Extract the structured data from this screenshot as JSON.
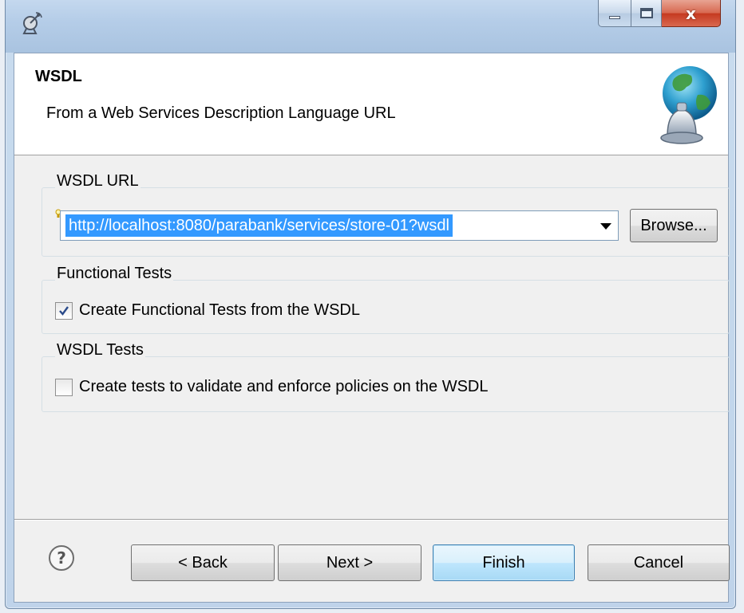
{
  "window": {
    "controls": {
      "minimize_icon": "minimize-icon",
      "maximize_icon": "maximize-icon",
      "close_glyph": "x"
    }
  },
  "header": {
    "title": "WSDL",
    "description": "From a Web Services Description Language URL"
  },
  "wsdl_url": {
    "group_label": "WSDL URL",
    "value": "http://localhost:8080/parabank/services/store-01?wsdl",
    "browse_label": "Browse..."
  },
  "functional_tests": {
    "group_label": "Functional Tests",
    "checkbox_label": "Create Functional Tests from the WSDL",
    "checked": true
  },
  "wsdl_tests": {
    "group_label": "WSDL Tests",
    "checkbox_label": "Create tests to validate and enforce policies on the WSDL",
    "checked": false
  },
  "footer": {
    "help_glyph": "?",
    "back_label": "< Back",
    "next_label": "Next >",
    "finish_label": "Finish",
    "cancel_label": "Cancel"
  },
  "colors": {
    "selection": "#3399ff",
    "default_button_border": "#3c7fb1"
  }
}
